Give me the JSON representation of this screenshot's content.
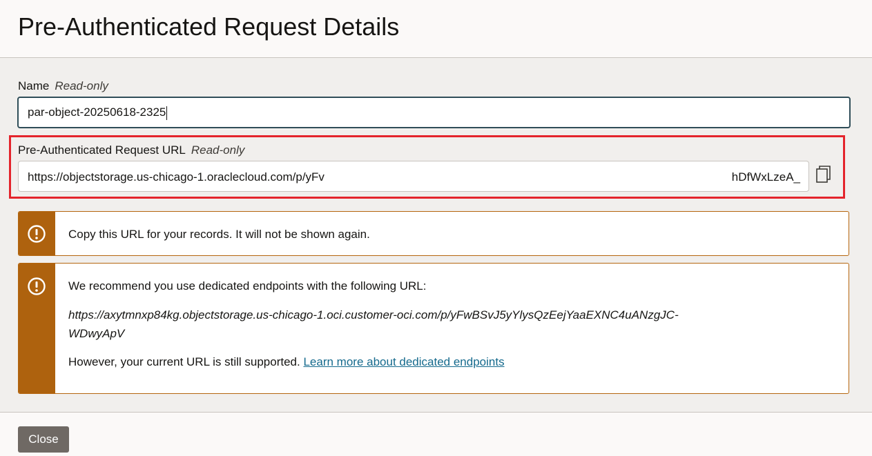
{
  "header": {
    "title": "Pre-Authenticated Request Details"
  },
  "name_field": {
    "label": "Name",
    "readonly_tag": "Read-only",
    "value": "par-object-20250618-2325"
  },
  "url_field": {
    "label": "Pre-Authenticated Request URL",
    "readonly_tag": "Read-only",
    "value_start": "https://objectstorage.us-chicago-1.oraclecloud.com/p/yFv",
    "value_end": "hDfWxLzeA_",
    "copy_icon": "copy-icon"
  },
  "highlight_color": "#e4242c",
  "warning_color": "#ae620e",
  "banner_records": {
    "icon": "exclamation-circle-icon",
    "text": "Copy this URL for your records. It will not be shown again."
  },
  "banner_endpoints": {
    "icon": "exclamation-circle-icon",
    "recommend_text": "We recommend you use dedicated endpoints with the following URL:",
    "url_line1": "https://axytmnxp84kg.objectstorage.us-chicago-1.oci.customer-oci.com/p/yFwBSvJ5yYlysQzEejYaaEXNC4uANzgJC-",
    "url_line2": "WDwyApV",
    "support_text": "However, your current URL is still supported.",
    "link_text": "Learn more about dedicated endpoints"
  },
  "footer": {
    "close_label": "Close"
  }
}
